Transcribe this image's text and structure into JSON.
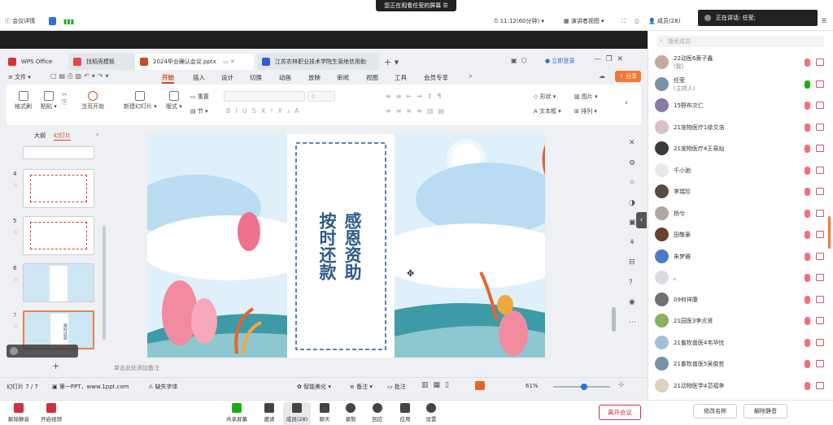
{
  "meeting": {
    "details_label": "会议详情",
    "share_banner": "您正在观看任莹的屏幕",
    "time": "11:12(60分钟)",
    "view_mode": "演讲者视图",
    "members_top": "成员(28)",
    "speaking_label": "正在讲话:",
    "speaking_name": "任莹;"
  },
  "wps": {
    "tabs": [
      {
        "label": "WPS Office",
        "color": "#d9323c"
      },
      {
        "label": "找稻壳模板",
        "color": "#e8454c"
      },
      {
        "label": "2024毕业确认会议.pptx",
        "color": "#d24726"
      },
      {
        "label": "江苏农林职业技术学院生源地信用助",
        "color": "#2b5fd9"
      }
    ],
    "login": "立即登录",
    "file_menu": "文件",
    "menus": [
      "开始",
      "插入",
      "设计",
      "切换",
      "动画",
      "放映",
      "审阅",
      "视图",
      "工具",
      "会员专享"
    ],
    "share_btn": "分享",
    "ribbon": {
      "format_painter": "格式刷",
      "paste": "粘贴",
      "from_current": "当页开始",
      "new_slide": "新建幻灯片",
      "layout": "版式",
      "reset": "重置",
      "section": "节",
      "shape": "形状",
      "textbox": "文本框",
      "image": "图片",
      "arrange": "排列",
      "font_size": "0"
    },
    "panel_tabs": [
      "大纲",
      "幻灯片"
    ],
    "thumb_numbers": [
      "4",
      "5",
      "6",
      "7"
    ],
    "slide_text_right": "感恩资助",
    "slide_text_left": "按时还款",
    "thumb_caption": "按时还款",
    "notes_placeholder": "单击此处添加备注",
    "status": {
      "slide_count": "幻灯片 7 / 7",
      "theme": "第一PPT，www.1ppt.com",
      "missing_font": "缺失字体",
      "beautify": "智能美化",
      "notes": "备注",
      "comments": "批注",
      "zoom": "61%"
    }
  },
  "toolbar": {
    "mute": "解除静音",
    "video": "开启视频",
    "share": "共享屏幕",
    "invite": "邀请",
    "members": "成员(28)",
    "chat": "聊天",
    "record": "录制",
    "interact": "回应",
    "apps": "应用",
    "settings": "设置",
    "leave": "离开会议"
  },
  "participants": {
    "search_placeholder": "搜索成员",
    "list": [
      {
        "name": "22动医6黄子鑫",
        "sub": "(我)",
        "color": "#c9a8a0"
      },
      {
        "name": "任莹",
        "sub": "(主持人)",
        "color": "#7a8fa8"
      },
      {
        "name": "15野布次仁",
        "sub": "",
        "color": "#8a7aa8"
      },
      {
        "name": "21宠物医疗1徐文浩",
        "sub": "",
        "color": "#d8c0c8"
      },
      {
        "name": "21宠物医疗4王易灿",
        "sub": "",
        "color": "#3a3a3a"
      },
      {
        "name": "千小驰",
        "sub": "",
        "color": "#e8e8e8"
      },
      {
        "name": "李瑞珍",
        "sub": "",
        "color": "#5a4a40"
      },
      {
        "name": "杨兮",
        "sub": "",
        "color": "#b0a8a0"
      },
      {
        "name": "田敬豪",
        "sub": "",
        "color": "#6a4030"
      },
      {
        "name": "朱梦雅",
        "sub": "",
        "color": "#4a7ac8"
      },
      {
        "name": "。",
        "sub": "",
        "color": "#d8dce0"
      },
      {
        "name": "09何祥康",
        "sub": "",
        "color": "#707070"
      },
      {
        "name": "21园医3李贞贤",
        "sub": "",
        "color": "#8ab060"
      },
      {
        "name": "21畜牧兽医4韦华忧",
        "sub": "",
        "color": "#a0c0d8"
      },
      {
        "name": "21畜牧兽医5吴俊哲",
        "sub": "",
        "color": "#7a90a8"
      },
      {
        "name": "21动物医学4范福李",
        "sub": "",
        "color": "#e0d0c0"
      }
    ],
    "rename_btn": "修改名称",
    "unmute_btn": "解除静音"
  }
}
